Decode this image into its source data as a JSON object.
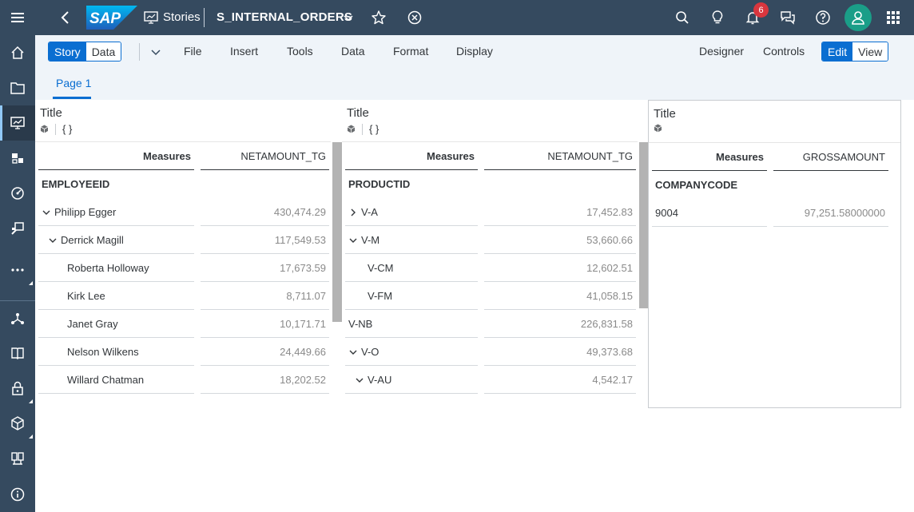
{
  "shell": {
    "logo_text": "SAP",
    "section_label": "Stories",
    "story_name": "S_INTERNAL_ORDERS",
    "notification_count": "6"
  },
  "toolbar": {
    "mode_story": "Story",
    "mode_data": "Data",
    "menus": [
      "File",
      "Insert",
      "Tools",
      "Data",
      "Format",
      "Display"
    ],
    "designer": "Designer",
    "controls": "Controls",
    "edit": "Edit",
    "view": "View"
  },
  "pages": [
    {
      "label": "Page 1"
    }
  ],
  "tables": [
    {
      "title": "Title",
      "formula_icon": "{ }",
      "measures_label": "Measures",
      "measure": "NETAMOUNT_TG",
      "dimension": "EMPLOYEEID",
      "rows": [
        {
          "label": "Philipp Egger",
          "value": "430,474.29",
          "indent": 0,
          "expand": "down"
        },
        {
          "label": "Derrick Magill",
          "value": "117,549.53",
          "indent": 1,
          "expand": "down"
        },
        {
          "label": "Roberta Holloway",
          "value": "17,673.59",
          "indent": 2,
          "expand": ""
        },
        {
          "label": "Kirk Lee",
          "value": "8,711.07",
          "indent": 2,
          "expand": ""
        },
        {
          "label": "Janet Gray",
          "value": "10,171.71",
          "indent": 2,
          "expand": ""
        },
        {
          "label": "Nelson Wilkens",
          "value": "24,449.66",
          "indent": 2,
          "expand": ""
        },
        {
          "label": "Willard Chatman",
          "value": "18,202.52",
          "indent": 2,
          "expand": ""
        }
      ]
    },
    {
      "title": "Title",
      "formula_icon": "{ }",
      "measures_label": "Measures",
      "measure": "NETAMOUNT_TG",
      "dimension": "PRODUCTID",
      "rows": [
        {
          "label": "V-A",
          "value": "17,452.83",
          "indent": 0,
          "expand": "right"
        },
        {
          "label": "V-M",
          "value": "53,660.66",
          "indent": 0,
          "expand": "down"
        },
        {
          "label": "V-CM",
          "value": "12,602.51",
          "indent": 1,
          "expand": ""
        },
        {
          "label": "V-FM",
          "value": "41,058.15",
          "indent": 1,
          "expand": ""
        },
        {
          "label": "V-NB",
          "value": "226,831.58",
          "indent": 0,
          "expand": ""
        },
        {
          "label": "V-O",
          "value": "49,373.68",
          "indent": 0,
          "expand": "down"
        },
        {
          "label": "V-AU",
          "value": "4,542.17",
          "indent": 1,
          "expand": "down"
        }
      ]
    },
    {
      "title": "Title",
      "formula_icon": "",
      "measures_label": "Measures",
      "measure": "GROSSAMOUNT",
      "dimension": "COMPANYCODE",
      "rows": [
        {
          "label": "9004",
          "value": "97,251.58000000",
          "indent": 0,
          "expand": ""
        }
      ]
    }
  ]
}
